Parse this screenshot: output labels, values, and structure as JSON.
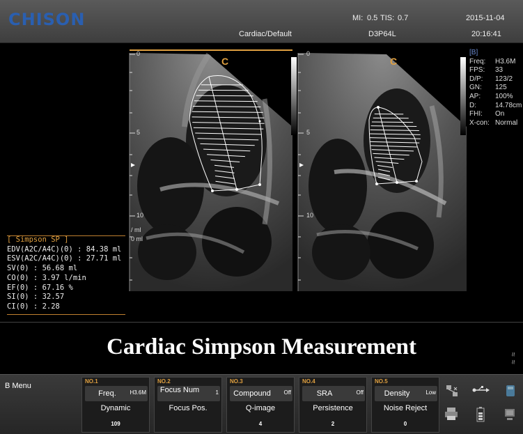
{
  "header": {
    "logo": "CHISON",
    "mi_label": "MI:",
    "mi_value": "0.5",
    "tis_label": "TIS:",
    "tis_value": "0.7",
    "date": "2015-11-04",
    "preset": "Cardiac/Default",
    "probe": "D3P64L",
    "time": "20:16:41"
  },
  "image": {
    "left_label": "C",
    "right_label": "C",
    "depth_ticks_left": [
      "0",
      "5",
      "10"
    ],
    "depth_ticks_right": [
      "0",
      "5",
      "10"
    ],
    "cut_labels": [
      "/ ml",
      "0 ml"
    ]
  },
  "params": {
    "tag": "[B]",
    "rows": [
      {
        "k": "Freq:",
        "v": "H3.6M"
      },
      {
        "k": "FPS:",
        "v": "33"
      },
      {
        "k": "D/P:",
        "v": "123/2"
      },
      {
        "k": "GN:",
        "v": "125"
      },
      {
        "k": "AP:",
        "v": "100%"
      },
      {
        "k": "D:",
        "v": "14.78cm"
      },
      {
        "k": "FHI:",
        "v": "On"
      },
      {
        "k": "X-con:",
        "v": "Normal"
      }
    ]
  },
  "measurement": {
    "title": "[ Simpson SP ]",
    "lines": [
      "EDV(A2C/A4C)(0) : 84.38 ml",
      "ESV(A2C/A4C)(0) : 27.71 ml",
      "SV(0) : 56.68 ml",
      "CO(0) : 3.97 l/min",
      "EF(0) : 67.16 %",
      "SI(0) : 32.57",
      "CI(0) : 2.28"
    ]
  },
  "banner": {
    "title": "Cardiac Simpson Measurement",
    "scroll_up": "≈",
    "scroll_down": "≈"
  },
  "menu": {
    "label": "B Menu",
    "groups": [
      {
        "no": "NO.1",
        "label": "Freq.",
        "value": "H3.6M",
        "sub": "Dynamic",
        "sub_value": "109"
      },
      {
        "no": "NO.2",
        "label": "Focus Num",
        "value": "1",
        "sub": "Focus Pos.",
        "sub_value": ""
      },
      {
        "no": "NO.3",
        "label": "Compound",
        "value": "Off",
        "sub": "Q-image",
        "sub_value": "4"
      },
      {
        "no": "NO.4",
        "label": "SRA",
        "value": "Off",
        "sub": "Persistence",
        "sub_value": "2"
      },
      {
        "no": "NO.5",
        "label": "Density",
        "value": "Low",
        "sub": "Noise Reject",
        "sub_value": "0"
      }
    ]
  },
  "colors": {
    "logo": "#2a5fb0",
    "accent": "#e0a040",
    "trace": "#ffffff"
  }
}
